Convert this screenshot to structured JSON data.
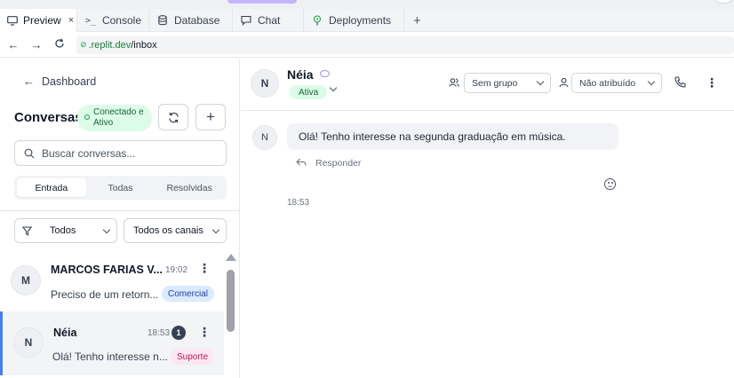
{
  "browser": {
    "tabs": [
      {
        "label": "Preview",
        "icon": "monitor-icon",
        "active": true
      },
      {
        "label": "Console",
        "icon": "terminal-icon"
      },
      {
        "label": "Database",
        "icon": "database-icon"
      },
      {
        "label": "Chat",
        "icon": "chat-icon"
      },
      {
        "label": "Deployments",
        "icon": "deploy-icon"
      }
    ],
    "tab_close": "×",
    "new_tab": "+",
    "url_host": ".replit.dev",
    "url_path": "/inbox"
  },
  "sidebar": {
    "back_label": "Dashboard",
    "title": "Conversas",
    "connection_status": "Conectado e Ativo",
    "search_placeholder": "Buscar conversas...",
    "tabs": [
      "Entrada",
      "Todas",
      "Resolvidas"
    ],
    "active_tab": "Entrada",
    "filter_status": "Todos",
    "filter_channel": "Todos os canais",
    "conversations": [
      {
        "initial": "M",
        "name": "MARCOS FARIAS V...",
        "time": "19:02",
        "preview": "Preciso de um retorn...",
        "tag": "Comercial",
        "tag_color": "#dbeafe",
        "tag_text_color": "#1e40af"
      },
      {
        "initial": "N",
        "name": "Néia",
        "time": "18:53",
        "unread": "1",
        "preview": "Olá! Tenho interesse n...",
        "tag": "Suporte",
        "tag_color": "#fce7f3",
        "tag_text_color": "#be185d",
        "selected": true
      }
    ]
  },
  "chat": {
    "contact_initial": "N",
    "contact_name": "Néia",
    "status": "Ativa",
    "group_select": "Sem grupo",
    "assign_select": "Não atribuído",
    "message": {
      "initial": "N",
      "text": "Olá! Tenho interesse na segunda graduação em música.",
      "reply_label": "Responder",
      "time": "18:53"
    }
  },
  "colors": {
    "accent": "#3b82f6",
    "success_bg": "#dcfce7",
    "success_text": "#166534"
  }
}
